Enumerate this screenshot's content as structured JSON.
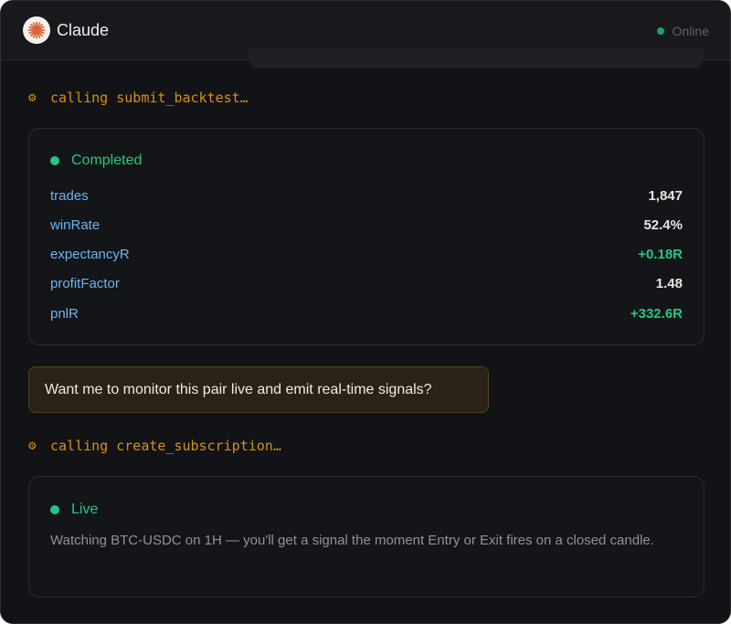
{
  "header": {
    "title": "Claude",
    "status": "Online"
  },
  "calls": {
    "first": "calling submit_backtest…",
    "second": "calling create_subscription…"
  },
  "backtest": {
    "status": "Completed",
    "metrics": [
      {
        "key": "trades",
        "value": "1,847"
      },
      {
        "key": "winRate",
        "value": "52.4%"
      },
      {
        "key": "expectancyR",
        "value": "+0.18R"
      },
      {
        "key": "profitFactor",
        "value": "1.48"
      },
      {
        "key": "pnlR",
        "value": "+332.6R"
      }
    ]
  },
  "user_message": "Want me to monitor this pair live and emit real-time signals?",
  "subscription": {
    "status": "Live",
    "description": "Watching BTC-USDC on 1H — you'll get a signal the moment Entry or Exit fires on a closed candle."
  },
  "colors": {
    "accent_green": "#25c685",
    "tool_orange": "#d98f16",
    "key_blue": "#6db3f2"
  },
  "icons": {
    "logo": "claude-starburst-icon",
    "tool": "gear-icon",
    "status": "status-dot-icon"
  }
}
